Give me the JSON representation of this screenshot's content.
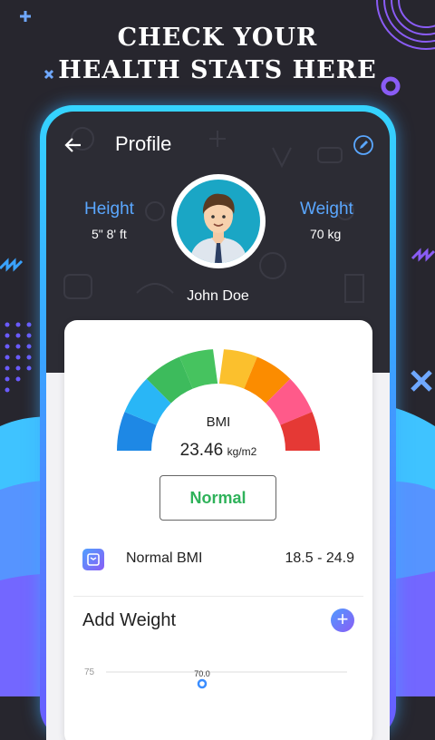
{
  "headline": {
    "line1": "CHECK YOUR",
    "line2": "HEALTH STATS HERE"
  },
  "appbar": {
    "title": "Profile",
    "back_icon": "arrow-left-icon",
    "edit_icon": "pencil-icon"
  },
  "stats": {
    "height_label": "Height",
    "height_value": "5\" 8' ft",
    "weight_label": "Weight",
    "weight_value": "70 kg"
  },
  "user": {
    "name": "John Doe"
  },
  "bmi": {
    "label": "BMI",
    "value": "23.46",
    "unit": "kg/m2",
    "status": "Normal"
  },
  "bmi_range": {
    "icon": "scale-icon",
    "label": "Normal BMI",
    "value": "18.5 - 24.9"
  },
  "add_weight": {
    "title": "Add Weight",
    "add_icon": "plus-icon"
  },
  "chart_data": {
    "type": "line",
    "y_tick_labels": [
      "75"
    ],
    "points": [
      {
        "label": "70.0",
        "value": 70.0
      }
    ]
  },
  "colors": {
    "accent_blue": "#5aa7ff",
    "status_green": "#2fb25a",
    "gauge": [
      "#1e88e5",
      "#29b6f6",
      "#3dbb5c",
      "#46c35f",
      "#fbc02d",
      "#fb8c00",
      "#ff5a8a",
      "#e53935"
    ]
  }
}
